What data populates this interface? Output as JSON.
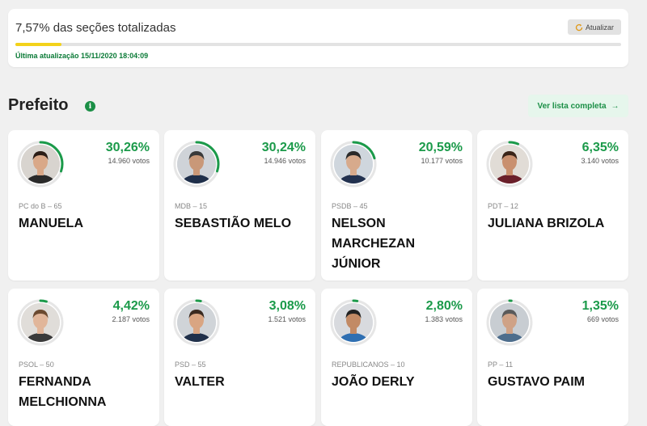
{
  "status": {
    "title": "7,57% das seções totalizadas",
    "progress_percent": 7.57,
    "refresh_label": "Atualizar",
    "update_text": "Última atualização 15/11/2020 18:04:09"
  },
  "section": {
    "title": "Prefeito",
    "list_label": "Ver lista completa"
  },
  "colors": {
    "accent": "#1b9a4a",
    "progress": "#f3d21a"
  },
  "candidates": [
    {
      "name": "MANUELA",
      "party": "PC do B – 65",
      "percent": "30,26%",
      "votes": "14.960 votos",
      "share": 30.26
    },
    {
      "name": "SEBASTIÃO MELO",
      "party": "MDB – 15",
      "percent": "30,24%",
      "votes": "14.946 votos",
      "share": 30.24
    },
    {
      "name": "NELSON MARCHEZAN JÚNIOR",
      "party": "PSDB – 45",
      "percent": "20,59%",
      "votes": "10.177 votos",
      "share": 20.59
    },
    {
      "name": "JULIANA BRIZOLA",
      "party": "PDT – 12",
      "percent": "6,35%",
      "votes": "3.140 votos",
      "share": 6.35
    },
    {
      "name": "FERNANDA MELCHIONNA",
      "party": "PSOL – 50",
      "percent": "4,42%",
      "votes": "2.187 votos",
      "share": 4.42
    },
    {
      "name": "VALTER",
      "party": "PSD – 55",
      "percent": "3,08%",
      "votes": "1.521 votos",
      "share": 3.08
    },
    {
      "name": "JOÃO DERLY",
      "party": "REPUBLICANOS – 10",
      "percent": "2,80%",
      "votes": "1.383 votos",
      "share": 2.8
    },
    {
      "name": "GUSTAVO PAIM",
      "party": "PP – 11",
      "percent": "1,35%",
      "votes": "669 votos",
      "share": 1.35
    }
  ]
}
